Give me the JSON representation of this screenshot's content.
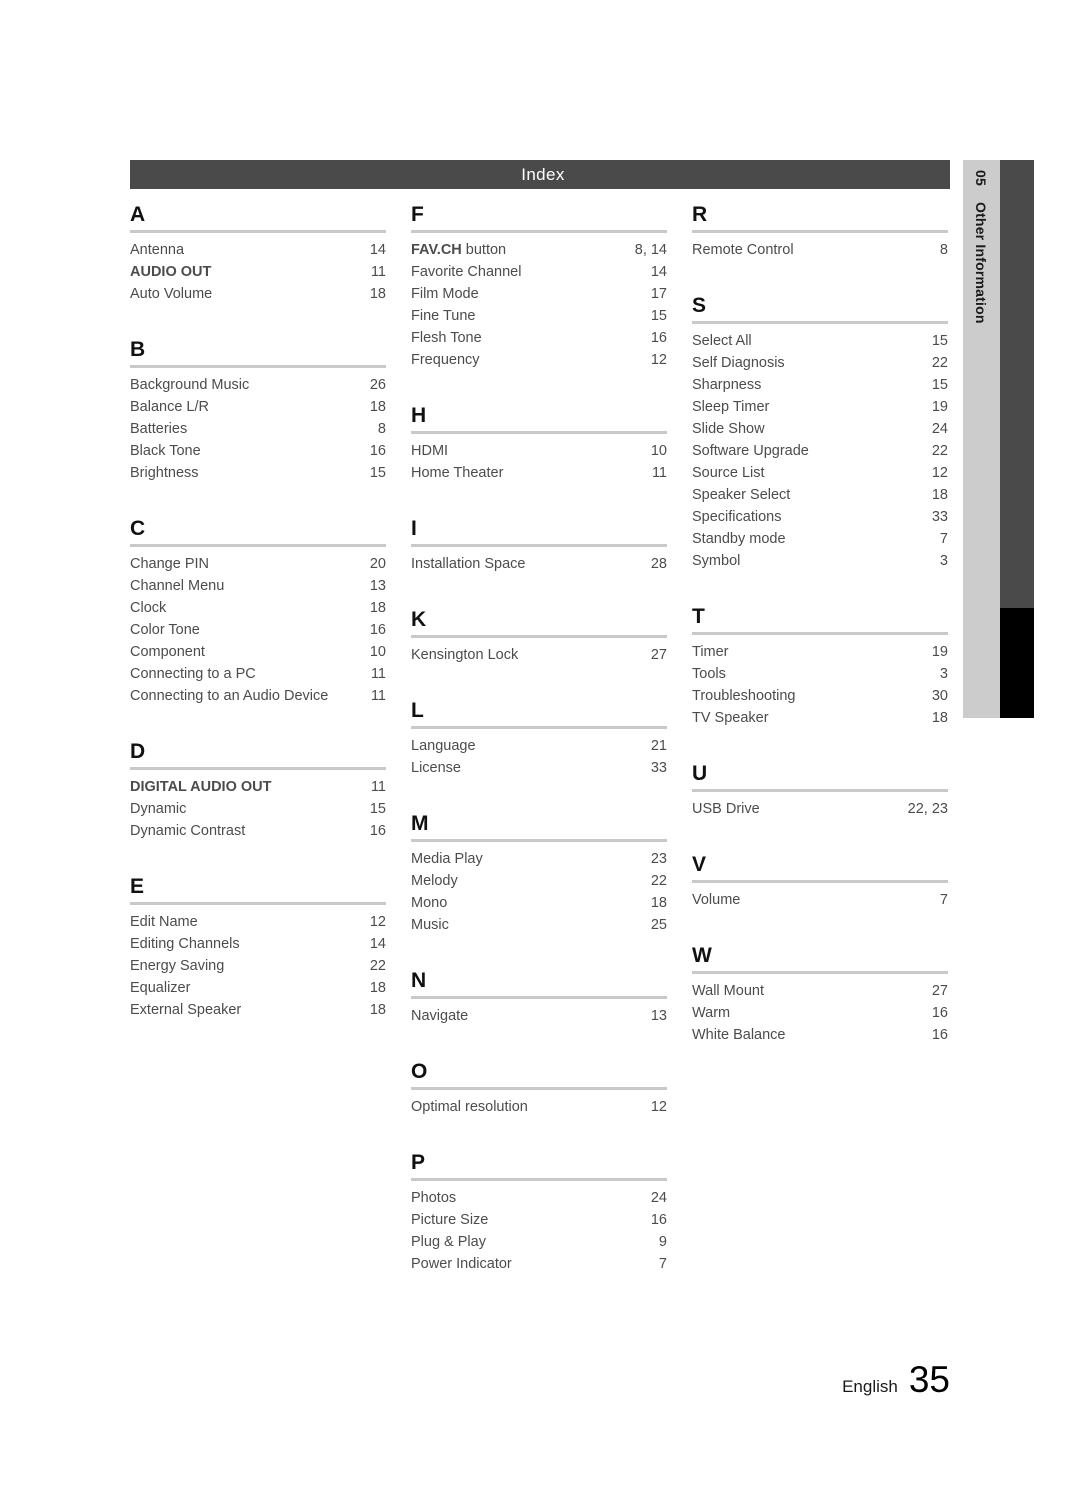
{
  "header": {
    "title": "Index"
  },
  "side_tab": {
    "chapter_number": "05",
    "chapter_label": "Other Information"
  },
  "footer": {
    "language": "English",
    "page_number": "35"
  },
  "colors": {
    "header_bar": "#4a4a4a",
    "side_tab": "#cccccc",
    "side_bar_gray": "#4a4a4a",
    "side_bar_black": "#000000",
    "rule": "#c9c9c9",
    "text": "#4c4c4c",
    "letter": "#111111"
  },
  "columns": [
    {
      "sections": [
        {
          "letter": "A",
          "entries": [
            {
              "label": "Antenna",
              "page": "14",
              "bold": false
            },
            {
              "label": "AUDIO OUT",
              "page": "11",
              "bold": true
            },
            {
              "label": "Auto Volume",
              "page": "18",
              "bold": false
            }
          ]
        },
        {
          "letter": "B",
          "entries": [
            {
              "label": "Background Music",
              "page": "26",
              "bold": false
            },
            {
              "label": "Balance  L/R",
              "page": "18",
              "bold": false
            },
            {
              "label": "Batteries",
              "page": "8",
              "bold": false
            },
            {
              "label": "Black Tone",
              "page": "16",
              "bold": false
            },
            {
              "label": "Brightness",
              "page": "15",
              "bold": false
            }
          ]
        },
        {
          "letter": "C",
          "entries": [
            {
              "label": "Change PIN",
              "page": "20",
              "bold": false
            },
            {
              "label": "Channel Menu",
              "page": "13",
              "bold": false
            },
            {
              "label": "Clock",
              "page": "18",
              "bold": false
            },
            {
              "label": "Color Tone",
              "page": "16",
              "bold": false
            },
            {
              "label": "Component",
              "page": "10",
              "bold": false
            },
            {
              "label": "Connecting to a PC",
              "page": "11",
              "bold": false
            },
            {
              "label": "Connecting to an Audio Device",
              "page": "11",
              "bold": false
            }
          ]
        },
        {
          "letter": "D",
          "entries": [
            {
              "label": "DIGITAL AUDIO OUT",
              "page": "11",
              "bold": true
            },
            {
              "label": "Dynamic",
              "page": "15",
              "bold": false
            },
            {
              "label": "Dynamic Contrast",
              "page": "16",
              "bold": false
            }
          ]
        },
        {
          "letter": "E",
          "entries": [
            {
              "label": "Edit Name",
              "page": "12",
              "bold": false
            },
            {
              "label": "Editing Channels",
              "page": "14",
              "bold": false
            },
            {
              "label": "Energy Saving",
              "page": "22",
              "bold": false
            },
            {
              "label": "Equalizer",
              "page": "18",
              "bold": false
            },
            {
              "label": "External Speaker",
              "page": "18",
              "bold": false
            }
          ]
        }
      ]
    },
    {
      "sections": [
        {
          "letter": "F",
          "entries": [
            {
              "label": "FAV.CH button",
              "page": "8, 14",
              "bold": false,
              "bold_prefix": "FAV.CH"
            },
            {
              "label": "Favorite Channel",
              "page": "14",
              "bold": false
            },
            {
              "label": "Film Mode",
              "page": "17",
              "bold": false
            },
            {
              "label": "Fine Tune",
              "page": "15",
              "bold": false
            },
            {
              "label": "Flesh Tone",
              "page": "16",
              "bold": false
            },
            {
              "label": "Frequency",
              "page": "12",
              "bold": false
            }
          ]
        },
        {
          "letter": "H",
          "entries": [
            {
              "label": "HDMI",
              "page": "10",
              "bold": false
            },
            {
              "label": "Home Theater",
              "page": "11",
              "bold": false
            }
          ]
        },
        {
          "letter": "I",
          "entries": [
            {
              "label": "Installation Space",
              "page": "28",
              "bold": false
            }
          ]
        },
        {
          "letter": "K",
          "entries": [
            {
              "label": "Kensington Lock",
              "page": "27",
              "bold": false
            }
          ]
        },
        {
          "letter": "L",
          "entries": [
            {
              "label": "Language",
              "page": "21",
              "bold": false
            },
            {
              "label": "License",
              "page": "33",
              "bold": false
            }
          ]
        },
        {
          "letter": "M",
          "entries": [
            {
              "label": "Media Play",
              "page": "23",
              "bold": false
            },
            {
              "label": "Melody",
              "page": "22",
              "bold": false
            },
            {
              "label": "Mono",
              "page": "18",
              "bold": false
            },
            {
              "label": "Music",
              "page": "25",
              "bold": false
            }
          ]
        },
        {
          "letter": "N",
          "entries": [
            {
              "label": "Navigate",
              "page": "13",
              "bold": false
            }
          ]
        },
        {
          "letter": "O",
          "entries": [
            {
              "label": "Optimal resolution",
              "page": "12",
              "bold": false
            }
          ]
        },
        {
          "letter": "P",
          "entries": [
            {
              "label": "Photos",
              "page": "24",
              "bold": false
            },
            {
              "label": "Picture Size",
              "page": "16",
              "bold": false
            },
            {
              "label": "Plug & Play",
              "page": "9",
              "bold": false
            },
            {
              "label": "Power Indicator",
              "page": "7",
              "bold": false
            }
          ]
        }
      ]
    },
    {
      "sections": [
        {
          "letter": "R",
          "entries": [
            {
              "label": "Remote Control",
              "page": "8",
              "bold": false
            }
          ]
        },
        {
          "letter": "S",
          "entries": [
            {
              "label": "Select All",
              "page": "15",
              "bold": false
            },
            {
              "label": "Self Diagnosis",
              "page": "22",
              "bold": false
            },
            {
              "label": "Sharpness",
              "page": "15",
              "bold": false
            },
            {
              "label": "Sleep Timer",
              "page": "19",
              "bold": false
            },
            {
              "label": "Slide Show",
              "page": "24",
              "bold": false
            },
            {
              "label": "Software Upgrade",
              "page": "22",
              "bold": false
            },
            {
              "label": "Source List",
              "page": "12",
              "bold": false
            },
            {
              "label": "Speaker Select",
              "page": "18",
              "bold": false
            },
            {
              "label": "Specifications",
              "page": "33",
              "bold": false
            },
            {
              "label": "Standby mode",
              "page": "7",
              "bold": false
            },
            {
              "label": "Symbol",
              "page": "3",
              "bold": false
            }
          ]
        },
        {
          "letter": "T",
          "entries": [
            {
              "label": "Timer",
              "page": "19",
              "bold": false
            },
            {
              "label": "Tools",
              "page": "3",
              "bold": false
            },
            {
              "label": "Troubleshooting",
              "page": "30",
              "bold": false
            },
            {
              "label": "TV Speaker",
              "page": "18",
              "bold": false
            }
          ]
        },
        {
          "letter": "U",
          "entries": [
            {
              "label": "USB Drive",
              "page": "22, 23",
              "bold": false
            }
          ]
        },
        {
          "letter": "V",
          "entries": [
            {
              "label": "Volume",
              "page": "7",
              "bold": false
            }
          ]
        },
        {
          "letter": "W",
          "entries": [
            {
              "label": "Wall Mount",
              "page": "27",
              "bold": false
            },
            {
              "label": "Warm",
              "page": "16",
              "bold": false
            },
            {
              "label": "White Balance",
              "page": "16",
              "bold": false
            }
          ]
        }
      ]
    }
  ]
}
